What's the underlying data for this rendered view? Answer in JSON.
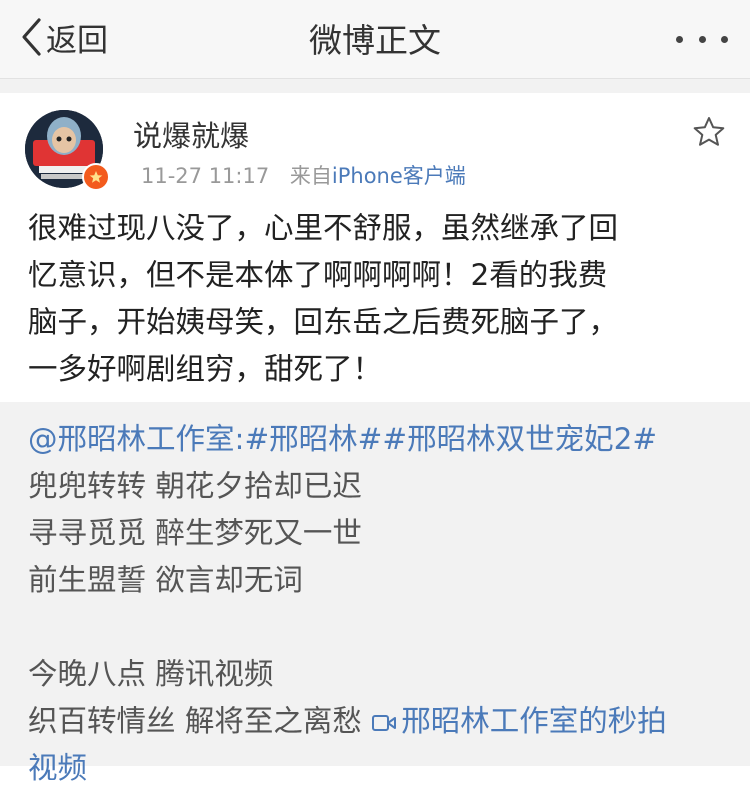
{
  "nav": {
    "back_label": "返回",
    "title": "微博正文"
  },
  "author": {
    "name": "说爆就爆",
    "time": "11-27 11:17",
    "from_prefix": "来自",
    "client": "iPhone客户端"
  },
  "post": {
    "lines": [
      "很难过现八没了，心里不舒服，虽然继承了回",
      "忆意识，但不是本体了啊啊啊啊！2看的我费",
      "脑子，开始姨母笑，回东岳之后费死脑子了，",
      "一多好啊剧组穷，甜死了！"
    ]
  },
  "repost": {
    "mention": "@邢昭林工作室",
    "colon": ":",
    "topic1": "#邢昭林#",
    "topic2": "#邢昭林双世宠妃2#",
    "poem": [
      "兜兜转转 朝花夕拾却已迟",
      "寻寻觅觅 醉生梦死又一世",
      "前生盟誓 欲言却无词"
    ],
    "notice": "今晚八点 腾讯视频",
    "last_text": "织百转情丝 解将至之离愁 ",
    "video_link": "邢昭林工作室的秒拍",
    "video_link_cont": "视频"
  },
  "colors": {
    "link": "#4b7ab9",
    "verified_badge": "#f35b1d",
    "repost_bg": "#f2f2f2"
  },
  "icons": {
    "back": "chevron-left-icon",
    "more": "more-dots-icon",
    "favorite": "star-outline-icon",
    "verified": "verified-badge-icon",
    "video": "video-camera-icon"
  }
}
